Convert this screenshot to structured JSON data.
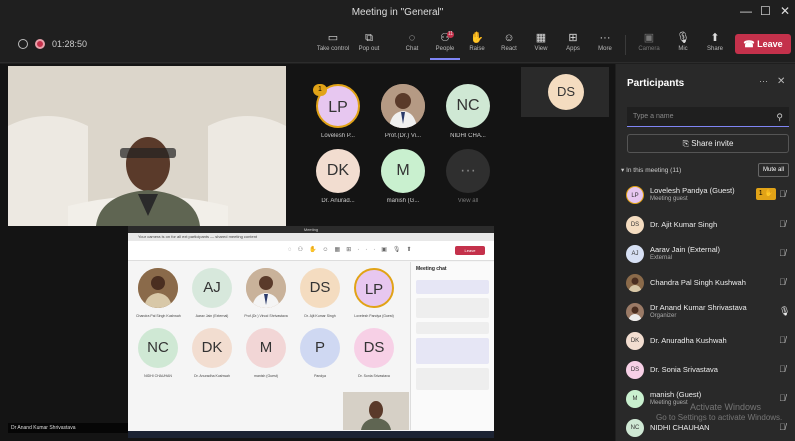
{
  "window": {
    "title": "Meeting in \"General\"",
    "minimize": "—",
    "maximize": "☐",
    "close": "✕"
  },
  "toolbar": {
    "timer": "01:28:50",
    "buttons": [
      {
        "label": "Take control",
        "icon": "control-icon"
      },
      {
        "label": "Pop out",
        "icon": "popout-icon"
      },
      {
        "label": "Chat",
        "icon": "chat-icon"
      },
      {
        "label": "People",
        "icon": "people-icon",
        "badge": "11"
      },
      {
        "label": "Raise",
        "icon": "hand-icon"
      },
      {
        "label": "React",
        "icon": "react-icon"
      },
      {
        "label": "View",
        "icon": "view-icon"
      },
      {
        "label": "Apps",
        "icon": "apps-icon"
      },
      {
        "label": "More",
        "icon": "more-icon"
      },
      {
        "label": "Camera",
        "icon": "camera-off-icon"
      },
      {
        "label": "Mic",
        "icon": "mic-off-icon"
      },
      {
        "label": "Share",
        "icon": "share-icon"
      }
    ],
    "leave_label": "Leave"
  },
  "stage": {
    "tiles": [
      {
        "initials": "LP",
        "name": "Lovelesh P...",
        "color": "#e7c7f0",
        "hand": "1"
      },
      {
        "initials": "",
        "name": "Prof.(Dr.) Vi...",
        "color": "#c9a58a",
        "photo": true
      },
      {
        "initials": "NC",
        "name": "NIDHI CHA...",
        "color": "#cfe8d4"
      },
      {
        "initials": "DK",
        "name": "Dr. Anurad...",
        "color": "#f2ddd0"
      },
      {
        "initials": "M",
        "name": "manish (G...",
        "color": "#c9f0cf"
      },
      {
        "initials": "···",
        "name": "View all",
        "color": "#2f2f2f"
      }
    ],
    "side_tile": {
      "initials": "DS",
      "color": "#f4dcc0"
    },
    "presenter_name": "Dr Anand Kumar Shrivastava",
    "share": {
      "title": "Meeting",
      "notice": "Your camera is on for all ext participants — shared meeting content",
      "leave": "Leave",
      "chat_header": "Meeting chat",
      "tiles": [
        {
          "initials": "",
          "name": "Chandra Pal Singh Kushwah",
          "color": "#b48a5a",
          "photo": true
        },
        {
          "initials": "AJ",
          "name": "Aarav Jain (External)",
          "color": "#d7e8dc"
        },
        {
          "initials": "",
          "name": "Prof.(Dr.) Vinod Shrivastava",
          "color": "#c9a58a",
          "photo": true
        },
        {
          "initials": "DS",
          "name": "Dr. Ajit Kumar Singh",
          "color": "#f4dcc0"
        },
        {
          "initials": "LP",
          "name": "Lovelesh Pandya (Guest)",
          "color": "#e7c7f0"
        },
        {
          "initials": "NC",
          "name": "NIDHI CHAUHAN",
          "color": "#cfe8d4"
        },
        {
          "initials": "DK",
          "name": "Dr. Anuradha Kushwah",
          "color": "#f2ddd0"
        },
        {
          "initials": "M",
          "name": "manish (Guest)",
          "color": "#f2d6d6"
        },
        {
          "initials": "P",
          "name": "Pandya",
          "color": "#cfd8f2"
        },
        {
          "initials": "DS",
          "name": "Dr. Sonia Srivastava",
          "color": "#f7d0e6"
        }
      ]
    }
  },
  "panel": {
    "title": "Participants",
    "search_placeholder": "Type a name",
    "share_invite": "Share invite",
    "in_meeting": "In this meeting (11)",
    "mute_all": "Mute all",
    "people": [
      {
        "initials": "LP",
        "name": "Lovelesh Pandya (Guest)",
        "sub": "Meeting guest",
        "color": "#e7c7f0",
        "hand": "1",
        "mic": "mic-off-icon"
      },
      {
        "initials": "DS",
        "name": "Dr. Ajit Kumar Singh",
        "sub": "",
        "color": "#f4dcc0",
        "mic": "mic-off-icon"
      },
      {
        "initials": "AJ",
        "name": "Aarav Jain (External)",
        "sub": "External",
        "color": "#d7e0f4",
        "mic": "mic-off-icon"
      },
      {
        "initials": "",
        "name": "Chandra Pal Singh Kushwah",
        "sub": "",
        "color": "#b48a5a",
        "photo": true,
        "mic": "mic-off-icon"
      },
      {
        "initials": "",
        "name": "Dr Anand Kumar Shrivastava",
        "sub": "Organizer",
        "color": "#9a7a66",
        "photo": true,
        "mic": "mic-on-icon"
      },
      {
        "initials": "DK",
        "name": "Dr. Anuradha Kushwah",
        "sub": "",
        "color": "#f2ddd0",
        "mic": "mic-off-icon"
      },
      {
        "initials": "DS",
        "name": "Dr. Sonia Srivastava",
        "sub": "",
        "color": "#f7d0e6",
        "mic": "mic-off-icon"
      },
      {
        "initials": "M",
        "name": "manish (Guest)",
        "sub": "Meeting guest",
        "color": "#c9f0cf",
        "mic": "mic-off-icon"
      },
      {
        "initials": "NC",
        "name": "NIDHI CHAUHAN",
        "sub": "",
        "color": "#cfe8d4",
        "mic": "mic-off-icon"
      }
    ]
  },
  "watermark": {
    "line1": "Activate Windows",
    "line2": "Go to Settings to activate Windows."
  }
}
